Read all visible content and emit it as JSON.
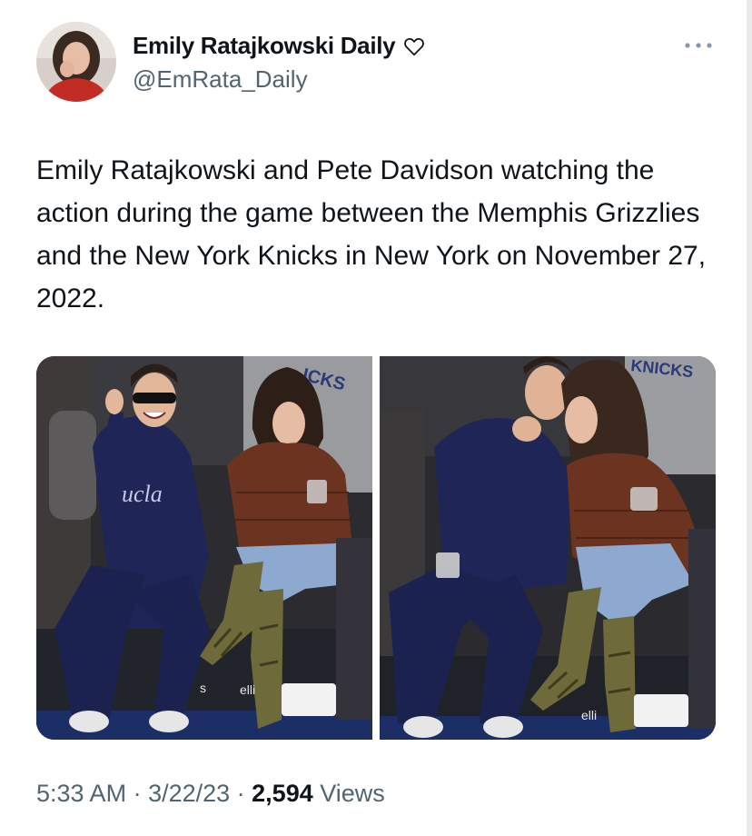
{
  "tweet": {
    "author": {
      "display_name": "Emily Ratajkowski Daily",
      "handle": "@EmRata_Daily",
      "name_icon": "heart-outline-icon",
      "avatar": "avatar"
    },
    "more_icon": "more-dots-icon",
    "text": "Emily Ratajkowski and Pete Davidson watching the action during the game between the Memphis Grizzlies and the New York Knicks in New York on November 27, 2022.",
    "media": {
      "left_photo": {
        "visible_text": [
          "ICKS",
          "ucla",
          "elli",
          "s"
        ]
      },
      "right_photo": {
        "visible_text": [
          "KNICKS",
          "elli"
        ]
      }
    },
    "footer": {
      "time": "5:33 AM",
      "separator": " · ",
      "date": "3/22/23",
      "views_count": "2,594",
      "views_label": "Views"
    }
  },
  "colors": {
    "text_primary": "#0f1419",
    "text_secondary": "#536471",
    "jacket_navy": "#1f2657",
    "jacket_brown": "#6b3320",
    "jeans_blue": "#8ea9cf",
    "boots_snake": "#6f6a3a"
  }
}
